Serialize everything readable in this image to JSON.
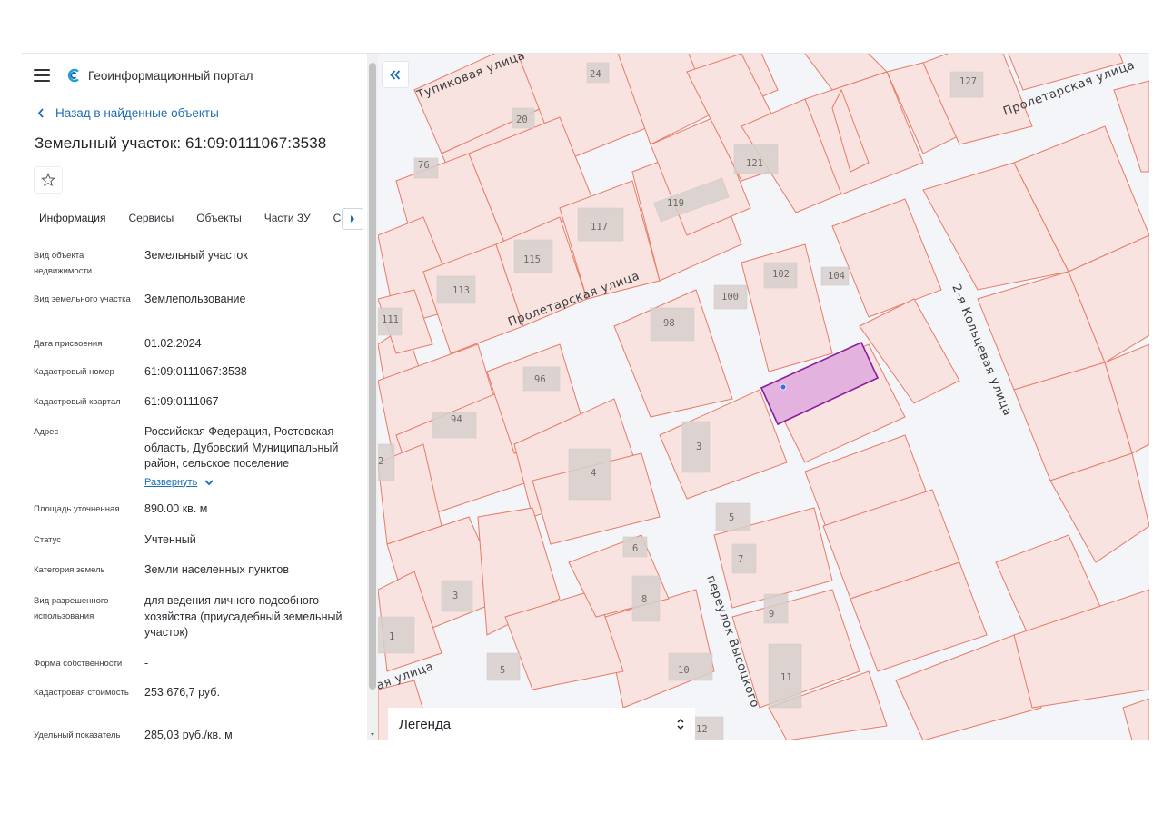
{
  "portal": {
    "title": "Геоинформационный портал"
  },
  "nav": {
    "back_label": "Назад в найденные объекты"
  },
  "object": {
    "title": "Земельный участок: 61:09:0111067:3538"
  },
  "tabs": [
    {
      "label": "Информация",
      "active": true
    },
    {
      "label": "Сервисы",
      "active": false
    },
    {
      "label": "Объекты",
      "active": false
    },
    {
      "label": "Части ЗУ",
      "active": false
    },
    {
      "label": "Состав",
      "active": false
    }
  ],
  "properties": [
    {
      "key": "Вид объекта недвижимости",
      "value": "Земельный участок"
    },
    {
      "key": "Вид земельного участка",
      "value": "Землепользование"
    },
    {
      "key": "Дата присвоения",
      "value": "01.02.2024"
    },
    {
      "key": "Кадастровый номер",
      "value": "61:09:0111067:3538"
    },
    {
      "key": "Кадастровый квартал",
      "value": "61:09:0111067"
    },
    {
      "key": "Адрес",
      "value": "Российская Федерация, Ростовская область, Дубовский Муниципальный район, сельское поселение",
      "expand_label": "Развернуть"
    },
    {
      "key": "Площадь уточненная",
      "value": "890.00 кв. м"
    },
    {
      "key": "Статус",
      "value": "Учтенный"
    },
    {
      "key": "Категория земель",
      "value": "Земли населенных пунктов"
    },
    {
      "key": "Вид разрешенного использования",
      "value": "для ведения личного подсобного хозяйства (приусадебный земельный участок)"
    },
    {
      "key": "Форма собственности",
      "value": "-"
    },
    {
      "key": "Кадастровая стоимость",
      "value": "253 676,7 руб."
    },
    {
      "key": "Удельный показатель",
      "value": "285,03 руб./кв. м"
    }
  ],
  "map": {
    "streets": [
      "Тупиковая улица",
      "Пролетарская улица",
      "Пролетарская улица",
      "2-я Кольцевая улица",
      "переулок Высоцкого",
      "ая улица"
    ],
    "house_numbers": [
      "24",
      "127",
      "20",
      "76",
      "121",
      "119",
      "117",
      "115",
      "113",
      "111",
      "102",
      "104",
      "100",
      "98",
      "96",
      "94",
      "2",
      "4",
      "3",
      "5",
      "6",
      "7",
      "8",
      "9",
      "3",
      "1",
      "5",
      "10",
      "11",
      "12"
    ],
    "legend_label": "Легенда",
    "colors": {
      "parcel_fill": "#f8e3e1",
      "parcel_stroke": "#e77b66",
      "selected_fill": "#e3b2df",
      "selected_stroke": "#8b1c9b",
      "accent": "#1b6eb5"
    }
  },
  "icons": [
    "menu-icon",
    "portal-logo-icon",
    "chevron-left-icon",
    "star-icon",
    "caret-right-icon",
    "chevron-down-icon",
    "double-chevron-left-icon",
    "up-down-icon"
  ]
}
